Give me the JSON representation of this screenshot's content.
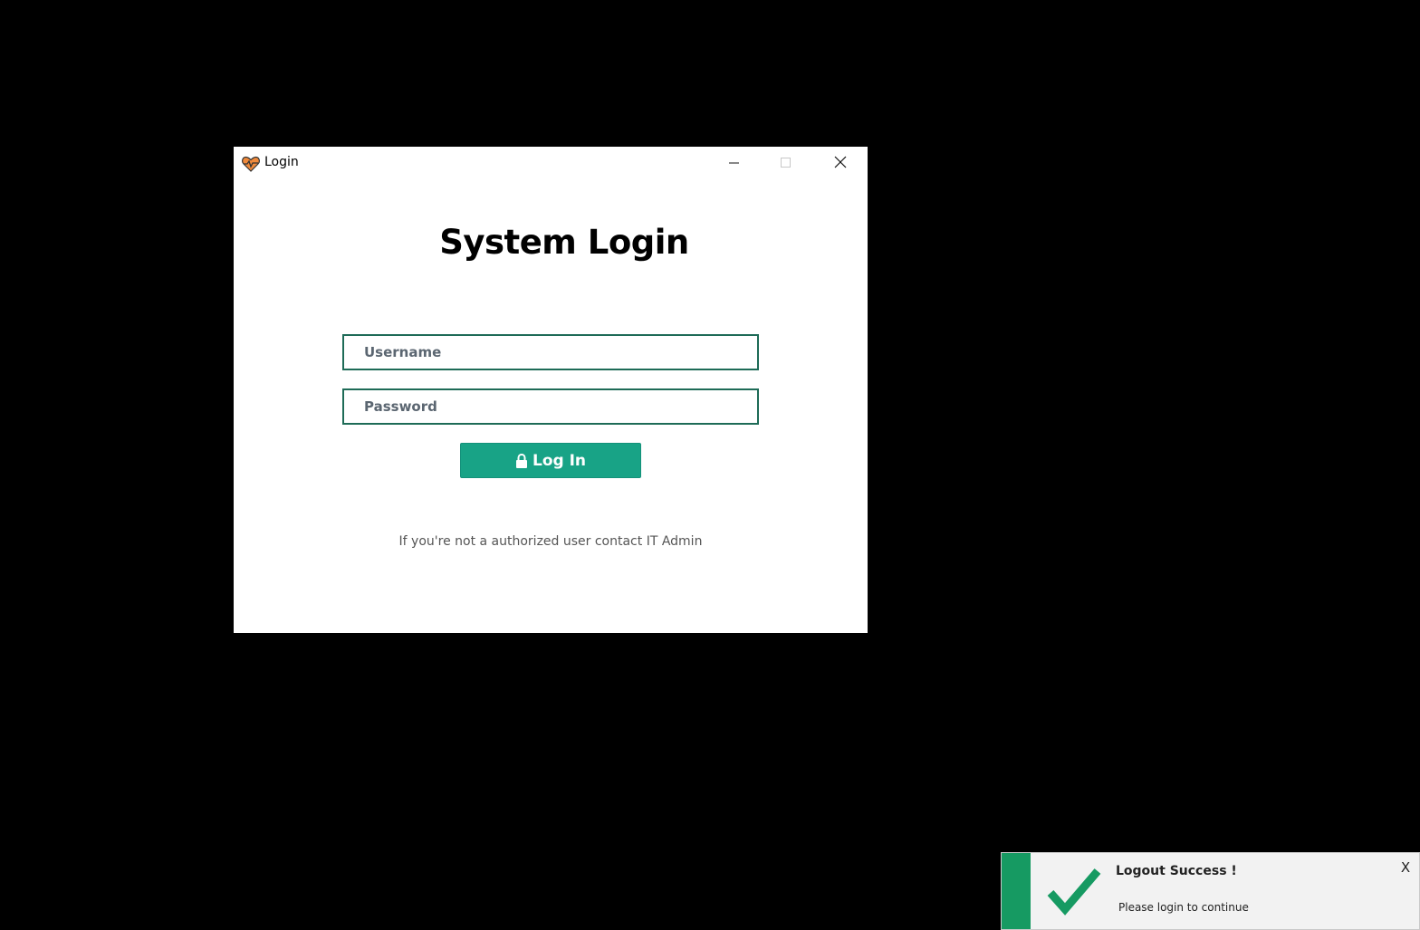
{
  "window": {
    "title": "Login",
    "app_icon": "heartbeat-heart-icon",
    "controls": {
      "minimize_icon": "minimize-icon",
      "maximize_icon": "maximize-icon",
      "close_icon": "close-icon"
    }
  },
  "login": {
    "heading": "System Login",
    "username_placeholder": "Username",
    "password_placeholder": "Password",
    "button_label": "Log In",
    "button_icon": "lock-icon",
    "hint": "If you're not a authorized user contact IT Admin"
  },
  "toast": {
    "title": "Logout Success !",
    "message": "Please login to continue",
    "close_label": "X",
    "icon": "checkmark-icon"
  },
  "colors": {
    "desktop_bg": "#000000",
    "window_bg": "#ffffff",
    "field_border": "#1e6b57",
    "button_bg": "#18a386",
    "toast_strip": "#169a62",
    "toast_check": "#169a62",
    "app_icon_heart": "#f08a3c"
  }
}
